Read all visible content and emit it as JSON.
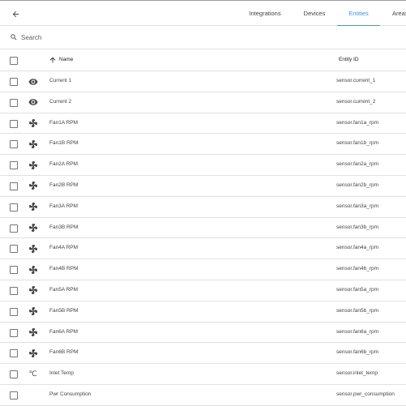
{
  "tabs": [
    {
      "label": "Integrations",
      "active": false
    },
    {
      "label": "Devices",
      "active": false
    },
    {
      "label": "Entities",
      "active": true
    },
    {
      "label": "Areas",
      "active": false
    }
  ],
  "search": {
    "placeholder": "Search"
  },
  "table": {
    "columns": {
      "name": "Name",
      "entity_id": "Entity ID"
    },
    "sort": "ascending",
    "rows": [
      {
        "icon": "eye-icon",
        "name": "Current 1",
        "entity_id": "sensor.current_1"
      },
      {
        "icon": "eye-icon",
        "name": "Current 2",
        "entity_id": "sensor.current_2"
      },
      {
        "icon": "fan-icon",
        "name": "Fan1A RPM",
        "entity_id": "sensor.fan1a_rpm"
      },
      {
        "icon": "fan-icon",
        "name": "Fan1B RPM",
        "entity_id": "sensor.fan1b_rpm"
      },
      {
        "icon": "fan-icon",
        "name": "Fan2A RPM",
        "entity_id": "sensor.fan2a_rpm"
      },
      {
        "icon": "fan-icon",
        "name": "Fan2B RPM",
        "entity_id": "sensor.fan2b_rpm"
      },
      {
        "icon": "fan-icon",
        "name": "Fan3A RPM",
        "entity_id": "sensor.fan3a_rpm"
      },
      {
        "icon": "fan-icon",
        "name": "Fan3B RPM",
        "entity_id": "sensor.fan3b_rpm"
      },
      {
        "icon": "fan-icon",
        "name": "Fan4A RPM",
        "entity_id": "sensor.fan4a_rpm"
      },
      {
        "icon": "fan-icon",
        "name": "Fan4B RPM",
        "entity_id": "sensor.fan4b_rpm"
      },
      {
        "icon": "fan-icon",
        "name": "Fan5A RPM",
        "entity_id": "sensor.fan5a_rpm"
      },
      {
        "icon": "fan-icon",
        "name": "Fan5B RPM",
        "entity_id": "sensor.fan5b_rpm"
      },
      {
        "icon": "fan-icon",
        "name": "Fan6A RPM",
        "entity_id": "sensor.fan6a_rpm"
      },
      {
        "icon": "fan-icon",
        "name": "Fan6B RPM",
        "entity_id": "sensor.fan6b_rpm"
      },
      {
        "icon": "celsius-icon",
        "name": "Inlet Temp",
        "entity_id": "sensor.inlet_temp"
      },
      {
        "icon": "",
        "name": "Pwr Consumption",
        "entity_id": "sensor.pwr_consumption"
      }
    ]
  },
  "colors": {
    "accent": "#4a90d9",
    "divider": "#e0e0e0",
    "icon": "#424242"
  }
}
